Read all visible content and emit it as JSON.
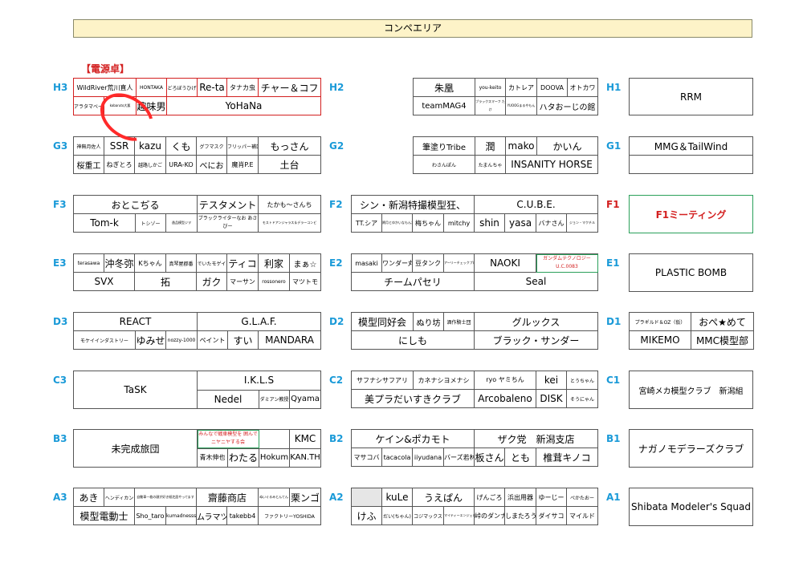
{
  "title": "コンペエリア",
  "power_label": "【電源卓】",
  "rows": {
    "H3": "H3",
    "H2": "H2",
    "H1": "H1",
    "G3": "G3",
    "G2": "G2",
    "G1": "G1",
    "F3": "F3",
    "F2": "F2",
    "F1": "F1",
    "E3": "E3",
    "E2": "E2",
    "E1": "E1",
    "D3": "D3",
    "D2": "D2",
    "D1": "D1",
    "C3": "C3",
    "C2": "C2",
    "C1": "C1",
    "B3": "B3",
    "B2": "B2",
    "B1": "B1",
    "A3": "A3",
    "A2": "A2",
    "A1": "A1"
  },
  "H3": [
    "WildRiver荒川直人",
    "HONTAKA",
    "どろぼうひげ",
    "Re-ta",
    "タナカ虫",
    "チャー＆コフ",
    "アラタマベース",
    "kobaruto大悪",
    "趣味男",
    "YoHaNa"
  ],
  "H2": [
    "朱凰",
    "you-keito",
    "カトレア",
    "DOOVA",
    "オトカワ",
    "teamMAG4",
    "ブラックスマーフ たけ",
    "YUOOGまるやもん",
    "ハタおーじの館"
  ],
  "H1": [
    "RRM"
  ],
  "G3": [
    "神無月佐人",
    "SSR",
    "kazu",
    "くも",
    "グフマスク",
    "フリッパー補口",
    "もっさん",
    "桜重工",
    "ねぎとろ",
    "越路しかご",
    "URA-KO",
    "べにお",
    "魔肖P.E",
    "土台"
  ],
  "G2": [
    "筆塗りTribe",
    "潤",
    "mako",
    "かいん",
    "わさんぽん",
    "たまんちゃ",
    "INSANITY HORSE"
  ],
  "G1": [
    "MMG＆TailWind",
    ""
  ],
  "F3": [
    "おとこぢる",
    "テスタメント",
    "たかも～さんち",
    "Tom-k",
    "トシゾー",
    "逸品模型ジヲ",
    "ブラックライターなお あさびー",
    "モストドアンジャラス＆デラーコンビ"
  ],
  "F2": [
    "シン・新潟特撮模型狂、",
    "C.U.B.E.",
    "TT.シア",
    "朔月とゆかいなもんたち",
    "梅ちゃん",
    "mitchy",
    "shin",
    "yasa",
    "バナさん",
    "ジョン・マクチル"
  ],
  "F1": [
    "F1ミーティング"
  ],
  "E3": [
    "terasawa",
    "沖冬弥",
    "Kちゃん",
    "真琴屋郡番",
    "でいたモゲイ",
    "ティコ",
    "利家",
    "まぁ☆",
    "SVX",
    "拓",
    "ガク",
    "マーサン",
    "rossonero",
    "マツトモ"
  ],
  "E2": [
    "masaki",
    "ワンダー丸",
    "豆タンク",
    "アーリーチェックプロ",
    "NAOKI",
    "ガンダムテクノロジー U.C.0083",
    "チームパセリ",
    "Seal"
  ],
  "E1": [
    "PLASTIC BOMB"
  ],
  "D3": [
    "REACT",
    "G.L.A.F.",
    "モケイインダストリー",
    "ゆみせ",
    "nozzy-1000",
    "ペイント",
    "すい",
    "MANDARA"
  ],
  "D2": [
    "模型同好会",
    "ぬり坊",
    "酒作騎士団",
    "グルックス",
    "にしも",
    "ブラック・サンダー"
  ],
  "D1": [
    "プラギルド＆OZ（仮）",
    "おぺ★めて",
    "MIKEMO",
    "MMC模型部"
  ],
  "C3": [
    "TaSK",
    "I.K.L.S",
    "Nedel",
    "ダミアン教授",
    "Qyama"
  ],
  "C2": [
    "サフナシサフアリ",
    "カネナシヨメナシ",
    "ryo ヤミちん",
    "kei",
    "とうちゃん",
    "美プラだいすきクラブ",
    "Arcobaleno",
    "DISK",
    "そうにゃん"
  ],
  "C1": [
    "宮崎メカ模型クラブ　新潟組"
  ],
  "B3": [
    "未完成旅団",
    "みんなで戦車模型を 囲んでニヤニヤする会",
    "",
    "KMC",
    "青木伸也",
    "わたる",
    "Hokum",
    "KAN.TH"
  ],
  "B2": [
    "ケイン&ポカモト",
    "ザク党　新潟支店",
    "マサコバ",
    "tacacola",
    "iiyudana",
    "バーズ若林",
    "板さん",
    "とも",
    "椎茸キノコ"
  ],
  "B1": [
    "ナガノモデラーズクラブ"
  ],
  "A3": [
    "あき",
    "ヘンディカン",
    "自動車一枚の顔が好き紙芝居やってます",
    "齋藤商店",
    "ぬいぐるみとんてん",
    "栗ンゴ",
    "模型電動士",
    "Sho_taro",
    "kumadnesss",
    "ムラマツ",
    "takebb4",
    "ファクトリーYOSHIDA"
  ],
  "A2": [
    "",
    "kuLe",
    "うえぱん",
    "げんごろ",
    "浜出用器",
    "ゆーじー",
    "ぺかたおー",
    "けふ",
    "だい(ちゃん)",
    "コジマックス",
    "マイティーエンジェルス",
    "峠のダンナ",
    "しまたろう",
    "ダイサコ",
    "マイルド"
  ],
  "A1": [
    "Shibata Modeler's Squad"
  ]
}
